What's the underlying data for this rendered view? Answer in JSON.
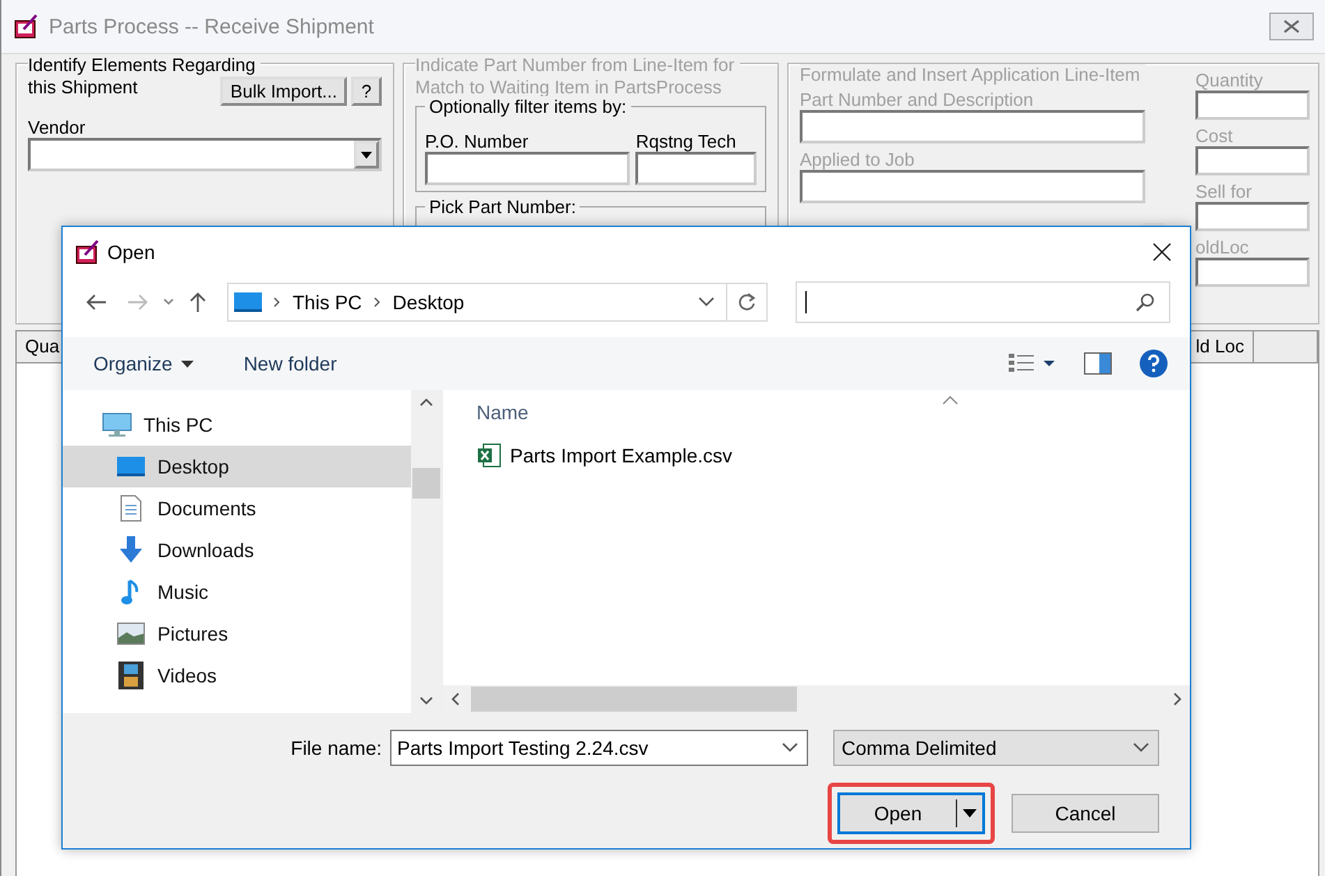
{
  "window": {
    "title": "Parts Process -- Receive Shipment"
  },
  "shipment_group": {
    "legend_lines": [
      "Identify Elements Regarding",
      "this Shipment"
    ],
    "bulk_import_button": "Bulk Import...",
    "help_button": "?",
    "vendor_label": "Vendor"
  },
  "match_group": {
    "legend_lines": [
      "Indicate Part Number from Line-Item for",
      "Match to Waiting Item in PartsProcess"
    ],
    "disabled": true,
    "filter_legend": "Optionally filter items by:",
    "po_label": "P.O. Number",
    "tech_label": "Rqstng Tech",
    "pick_legend": "Pick Part Number:"
  },
  "line_item_group": {
    "legend": "Formulate and Insert Application Line-Item",
    "disabled": true,
    "fields": [
      {
        "label": "Part Number and Description"
      },
      {
        "label": "Applied to Job"
      }
    ],
    "side_fields": [
      {
        "label": "Quantity"
      },
      {
        "label": "Cost"
      },
      {
        "label": "Sell for"
      },
      {
        "label": "oldLoc"
      }
    ]
  },
  "table": {
    "columns": [
      "Qua",
      "ld Loc"
    ]
  },
  "dialog": {
    "title": "Open",
    "breadcrumb": [
      "This PC",
      "Desktop"
    ],
    "toolbar": {
      "organize": "Organize",
      "new_folder": "New folder"
    },
    "nav": [
      {
        "label": "This PC",
        "kind": "pc",
        "selected": false,
        "children": [
          {
            "label": "Desktop",
            "kind": "desktop",
            "selected": true
          },
          {
            "label": "Documents",
            "kind": "documents",
            "selected": false
          },
          {
            "label": "Downloads",
            "kind": "downloads",
            "selected": false
          },
          {
            "label": "Music",
            "kind": "music",
            "selected": false
          },
          {
            "label": "Pictures",
            "kind": "pictures",
            "selected": false
          },
          {
            "label": "Videos",
            "kind": "videos",
            "selected": false
          }
        ]
      }
    ],
    "list_header": "Name",
    "files": [
      {
        "name": "Parts Import Example.csv"
      }
    ],
    "file_name_label": "File name:",
    "file_name": "Parts Import Testing 2.24.csv",
    "file_type": "Comma Delimited",
    "open_button": {
      "label": "Open",
      "highlighted": true
    },
    "cancel_button": "Cancel"
  }
}
